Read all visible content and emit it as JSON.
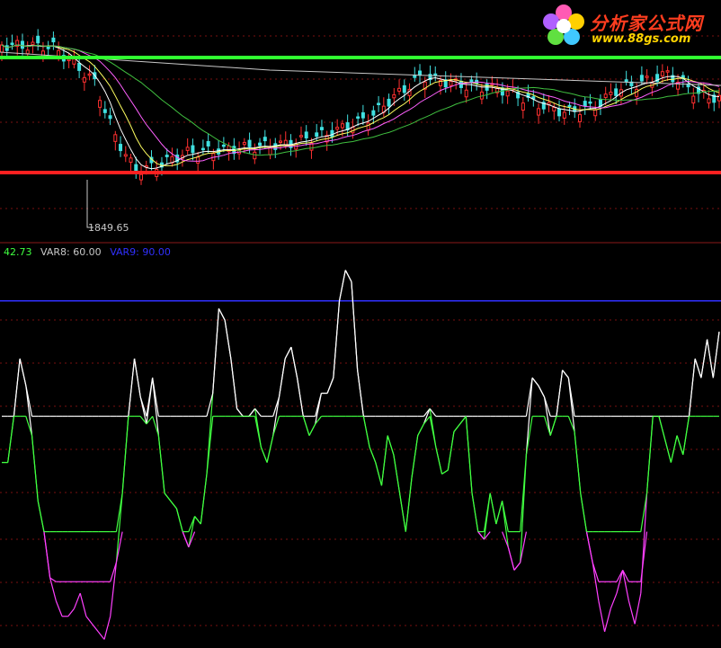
{
  "logo": {
    "title": "分析家公式网",
    "url": "www.88gs.com",
    "colors": {
      "title": "#ff3d1f",
      "url": "#ffd400"
    }
  },
  "readout": {
    "value": "42.73",
    "var8_label": "VAR8: 60.00",
    "var9_label": "VAR9: 90.00",
    "colors": {
      "value": "#40ff40",
      "var8": "#c8c8c8",
      "var9": "#3030ff"
    }
  },
  "price_panel": {
    "low_marker": "1849.65",
    "support_color": "#ff2020",
    "resistance_color": "#30ff30"
  },
  "chart_data": {
    "type": "line",
    "levels": {
      "var8": 60,
      "var9": 90
    },
    "colors": {
      "main": "#ffffff",
      "green": "#40ff40",
      "magenta": "#ff40ff",
      "blue": "#3030ff"
    },
    "grid": "dotted horizontal",
    "indicator": [
      48,
      48,
      60,
      75,
      68,
      55,
      38,
      30,
      18,
      12,
      8,
      8,
      10,
      14,
      8,
      6,
      4,
      2,
      8,
      22,
      40,
      60,
      75,
      65,
      58,
      70,
      55,
      40,
      38,
      36,
      30,
      26,
      34,
      32,
      45,
      66,
      88,
      85,
      75,
      62,
      60,
      60,
      62,
      52,
      48,
      55,
      65,
      75,
      78,
      70,
      60,
      55,
      58,
      66,
      66,
      70,
      90,
      98,
      95,
      72,
      60,
      52,
      48,
      42,
      55,
      50,
      40,
      30,
      44,
      55,
      58,
      62,
      52,
      45,
      46,
      56,
      58,
      60,
      40,
      30,
      28,
      40,
      32,
      38,
      26,
      20,
      22,
      50,
      70,
      68,
      65,
      55,
      60,
      72,
      70,
      56,
      40,
      30,
      22,
      12,
      4,
      10,
      14,
      20,
      12,
      6,
      14,
      40,
      60,
      60,
      54,
      48,
      55,
      50,
      60,
      75,
      70,
      80,
      70,
      82
    ]
  }
}
